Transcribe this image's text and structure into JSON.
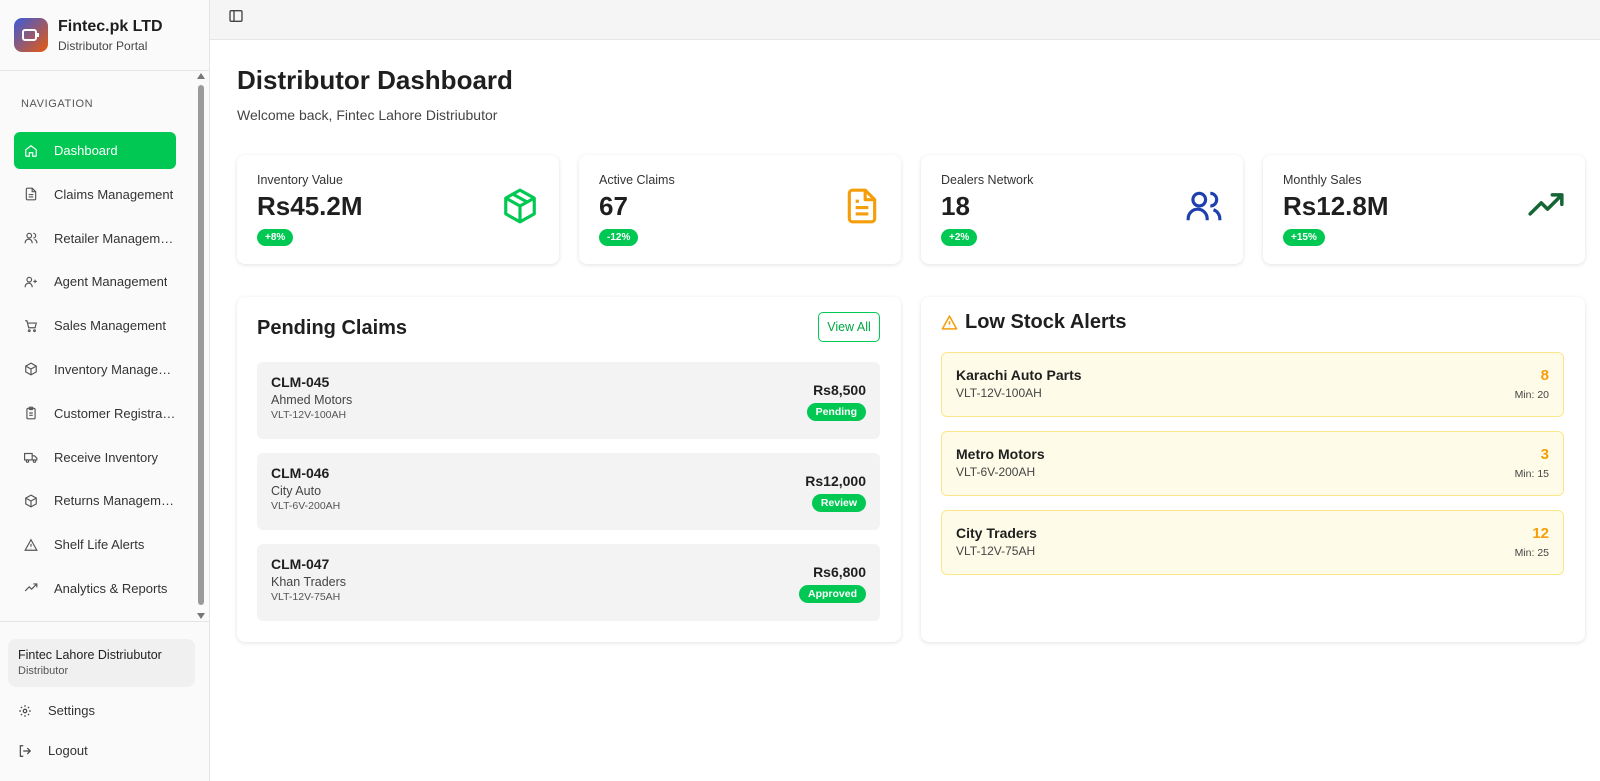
{
  "brand": {
    "name": "Fintec.pk LTD",
    "subtitle": "Distributor Portal"
  },
  "nav": {
    "heading": "NAVIGATION",
    "items": [
      {
        "label": "Dashboard",
        "icon": "home-icon",
        "active": true
      },
      {
        "label": "Claims Management",
        "icon": "document-icon"
      },
      {
        "label": "Retailer Management",
        "icon": "users-icon"
      },
      {
        "label": "Agent Management",
        "icon": "user-plus-icon"
      },
      {
        "label": "Sales Management",
        "icon": "cart-icon"
      },
      {
        "label": "Inventory Management",
        "icon": "box-icon"
      },
      {
        "label": "Customer Registration",
        "icon": "clipboard-icon"
      },
      {
        "label": "Receive Inventory",
        "icon": "truck-icon"
      },
      {
        "label": "Returns Management",
        "icon": "box-icon"
      },
      {
        "label": "Shelf Life Alerts",
        "icon": "warning-icon"
      },
      {
        "label": "Analytics & Reports",
        "icon": "trend-up-icon"
      }
    ]
  },
  "user": {
    "name": "Fintec Lahore Distriubutor",
    "role": "Distributor"
  },
  "footer": {
    "settings": "Settings",
    "logout": "Logout"
  },
  "page": {
    "title": "Distributor Dashboard",
    "subtitle": "Welcome back, Fintec Lahore Distriubutor"
  },
  "stats": [
    {
      "label": "Inventory Value",
      "value": "Rs45.2M",
      "change": "+8%",
      "icon": "box-icon",
      "color": "#00c853"
    },
    {
      "label": "Active Claims",
      "value": "67",
      "change": "-12%",
      "icon": "document-icon",
      "color": "#f59e0b"
    },
    {
      "label": "Dealers Network",
      "value": "18",
      "change": "+2%",
      "icon": "users-icon",
      "color": "#1e40af"
    },
    {
      "label": "Monthly Sales",
      "value": "Rs12.8M",
      "change": "+15%",
      "icon": "trend-up-icon",
      "color": "#166534"
    }
  ],
  "pending_claims": {
    "title": "Pending Claims",
    "view_all": "View All",
    "items": [
      {
        "id": "CLM-045",
        "dealer": "Ahmed Motors",
        "sku": "VLT-12V-100AH",
        "amount": "Rs8,500",
        "status": "Pending"
      },
      {
        "id": "CLM-046",
        "dealer": "City Auto",
        "sku": "VLT-6V-200AH",
        "amount": "Rs12,000",
        "status": "Review"
      },
      {
        "id": "CLM-047",
        "dealer": "Khan Traders",
        "sku": "VLT-12V-75AH",
        "amount": "Rs6,800",
        "status": "Approved"
      }
    ]
  },
  "low_stock": {
    "title": "Low Stock Alerts",
    "items": [
      {
        "name": "Karachi Auto Parts",
        "sku": "VLT-12V-100AH",
        "qty": "8",
        "min": "Min: 20"
      },
      {
        "name": "Metro Motors",
        "sku": "VLT-6V-200AH",
        "qty": "3",
        "min": "Min: 15"
      },
      {
        "name": "City Traders",
        "sku": "VLT-12V-75AH",
        "qty": "12",
        "min": "Min: 25"
      }
    ]
  }
}
